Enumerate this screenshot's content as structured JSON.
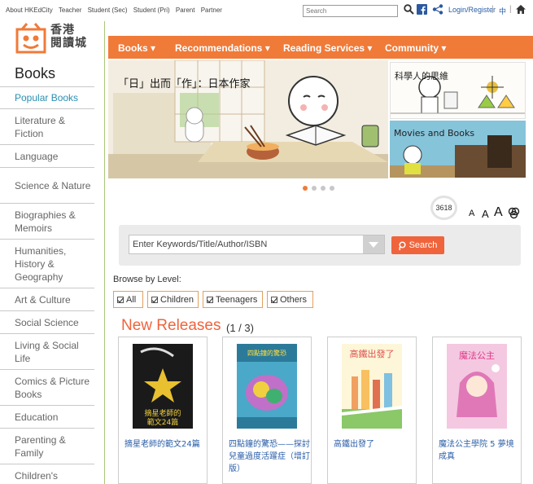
{
  "top_links": [
    "About HKEdCity",
    "Teacher",
    "Student (Sec)",
    "Student (Pri)",
    "Parent",
    "Partner"
  ],
  "search_top": {
    "placeholder": "Search"
  },
  "login_label": "Login/Register",
  "lang_label": "中",
  "logo": {
    "line1": "香港",
    "line2": "閱讀城"
  },
  "sidebar": {
    "title": "Books",
    "items": [
      {
        "label": "Popular Books"
      },
      {
        "label": "Literature & Fiction"
      },
      {
        "label": "Language"
      },
      {
        "label": "Science & Nature"
      },
      {
        "label": "Biographies & Memoirs"
      },
      {
        "label": "Humanities, History & Geography"
      },
      {
        "label": "Art & Culture"
      },
      {
        "label": "Social Science"
      },
      {
        "label": "Living & Social Life"
      },
      {
        "label": "Comics & Picture Books"
      },
      {
        "label": "Education"
      },
      {
        "label": "Parenting & Family"
      },
      {
        "label": "Children's"
      }
    ]
  },
  "nav": [
    "Books",
    "Recommendations",
    "Reading Services",
    "Community"
  ],
  "banner": {
    "title": "「日」出而「作」：日本作家"
  },
  "side_banners": [
    "科學人的思維",
    "Movies and Books"
  ],
  "counter": "3618",
  "font_sizes": [
    "A",
    "A",
    "A"
  ],
  "search": {
    "placeholder": "Enter Keywords/Title/Author/ISBN",
    "button": "Search"
  },
  "browse_label": "Browse by Level:",
  "levels": [
    "All",
    "Children",
    "Teenagers",
    "Others"
  ],
  "new_releases": {
    "title": "New Releases",
    "page": "(1 / 3)"
  },
  "books": [
    {
      "title": "摘星老師的範文24篇",
      "cover_text": "摘星老師的範文24篇"
    },
    {
      "title": "四點鐘的驚恐——探討兒童過度活躍症（增訂版）",
      "cover_text": "四點鐘的驚恐"
    },
    {
      "title": "高鐵出發了",
      "cover_text": "高鐵出發了"
    },
    {
      "title": "魔法公主學院 5 夢境成真",
      "cover_text": "魔法公主學院"
    }
  ],
  "colors": {
    "accent": "#f07a38",
    "link": "#2a5ea8",
    "side_active": "#2a8fb3"
  }
}
